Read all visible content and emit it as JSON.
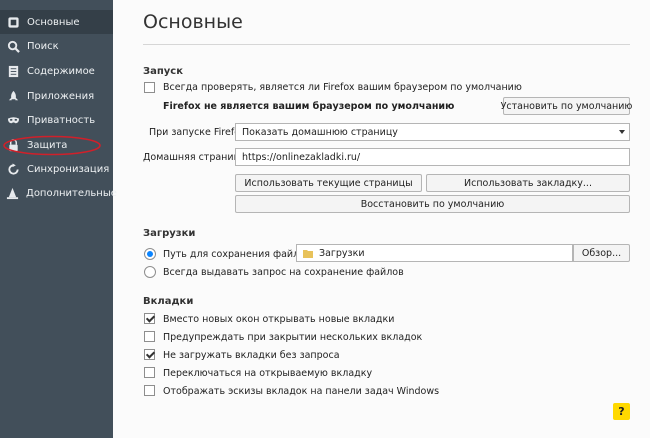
{
  "sidebar": {
    "items": [
      {
        "label": "Основные",
        "icon": "gear-icon"
      },
      {
        "label": "Поиск",
        "icon": "search-icon"
      },
      {
        "label": "Содержимое",
        "icon": "document-icon"
      },
      {
        "label": "Приложения",
        "icon": "rocket-icon"
      },
      {
        "label": "Приватность",
        "icon": "mask-icon"
      },
      {
        "label": "Защита",
        "icon": "lock-icon"
      },
      {
        "label": "Синхронизация",
        "icon": "sync-icon"
      },
      {
        "label": "Дополнительные",
        "icon": "wizard-hat-icon"
      }
    ],
    "active": "Основные",
    "highlight_color": "#d0202a"
  },
  "main": {
    "title": "Основные",
    "startup": {
      "heading": "Запуск",
      "default_check_label": "Всегда проверять, является ли Firefox вашим браузером по умолчанию",
      "default_check_checked": false,
      "not_default_text": "Firefox не является вашим браузером по умолчанию",
      "set_default_button": "Установить по умолчанию",
      "on_start_label": "При запуске Firefox:",
      "on_start_value": "Показать домашнюю страницу",
      "homepage_label": "Домашняя страница:",
      "homepage_value": "https://onlinezakladki.ru/",
      "use_current_button": "Использовать текущие страницы",
      "use_bookmark_button": "Использовать закладку...",
      "restore_default_button": "Восстановить по умолчанию"
    },
    "downloads": {
      "heading": "Загрузки",
      "save_path_label": "Путь для сохранения файлов",
      "save_path_selected": true,
      "folder_value": "Загрузки",
      "browse_button": "Обзор...",
      "always_ask_label": "Всегда выдавать запрос на сохранение файлов"
    },
    "tabs": {
      "heading": "Вкладки",
      "options": [
        {
          "label": "Вместо новых окон открывать новые вкладки",
          "checked": true
        },
        {
          "label": "Предупреждать при закрытии нескольких вкладок",
          "checked": false
        },
        {
          "label": "Не загружать вкладки без запроса",
          "checked": true
        },
        {
          "label": "Переключаться на открываемую вкладку",
          "checked": false
        },
        {
          "label": "Отображать эскизы вкладок на панели задач Windows",
          "checked": false
        }
      ]
    },
    "help_label": "?"
  }
}
